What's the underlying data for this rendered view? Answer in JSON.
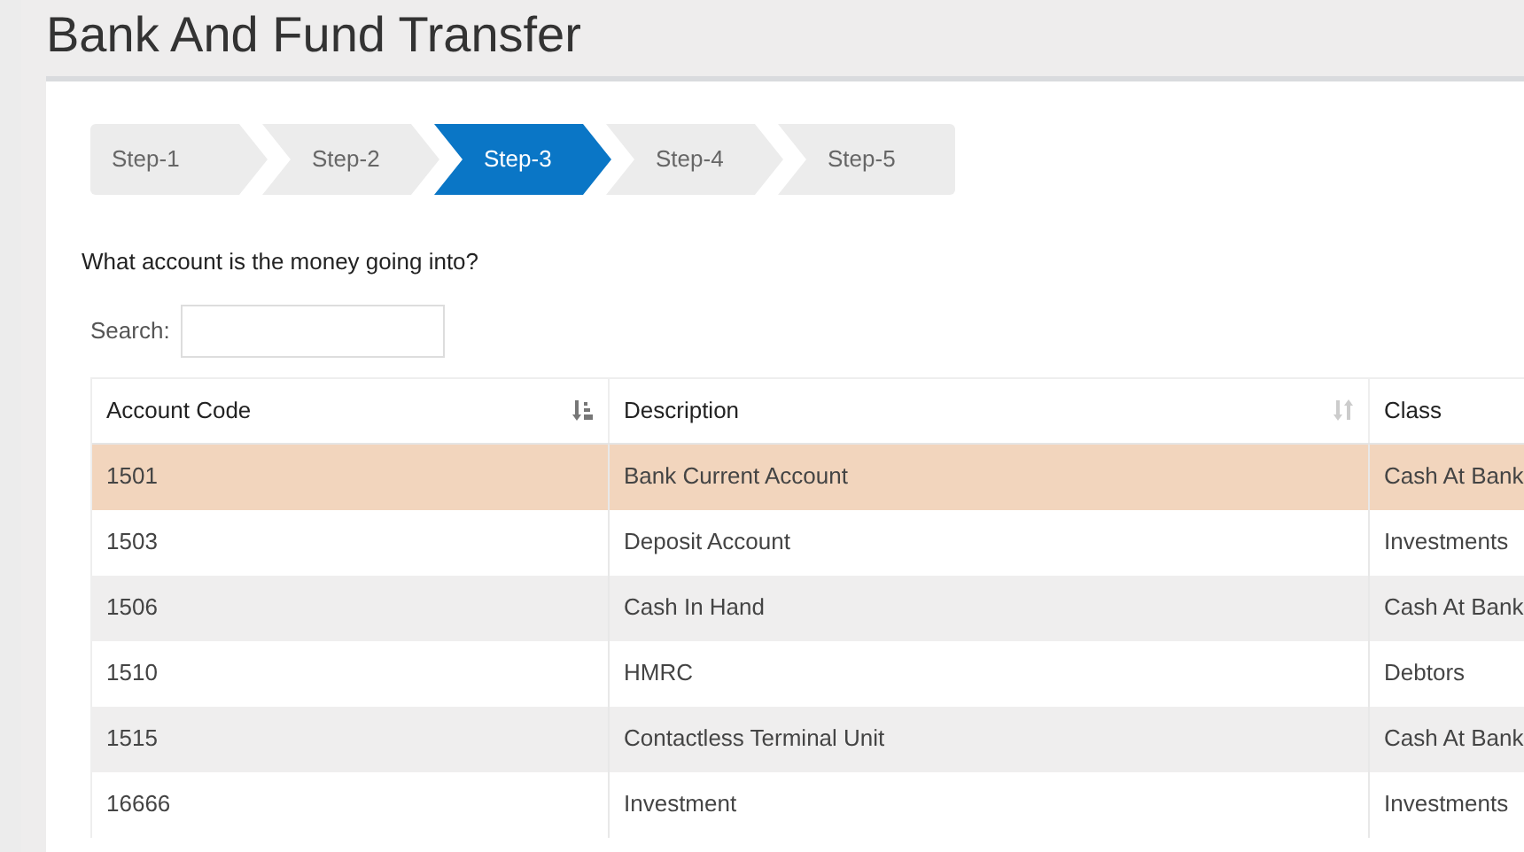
{
  "page_title": "Bank And Fund Transfer",
  "steps": [
    {
      "label": "Step-1",
      "selected": false
    },
    {
      "label": "Step-2",
      "selected": false
    },
    {
      "label": "Step-3",
      "selected": true
    },
    {
      "label": "Step-4",
      "selected": false
    },
    {
      "label": "Step-5",
      "selected": false
    }
  ],
  "question": "What account is the money going into?",
  "search": {
    "label": "Search:"
  },
  "table": {
    "columns": [
      {
        "label": "Account Code",
        "sorted": true
      },
      {
        "label": "Description",
        "sorted": false
      },
      {
        "label": "Class"
      }
    ],
    "rows": [
      {
        "cells": [
          "1501",
          "Bank Current Account",
          "Cash At Bank"
        ],
        "selected": true
      },
      {
        "cells": [
          "1503",
          "Deposit Account",
          "Investments"
        ],
        "selected": false
      },
      {
        "cells": [
          "1506",
          "Cash In Hand",
          "Cash At Bank"
        ],
        "selected": false
      },
      {
        "cells": [
          "1510",
          "HMRC",
          "Debtors"
        ],
        "selected": false
      },
      {
        "cells": [
          "1515",
          "Contactless Terminal Unit",
          "Cash At Bank"
        ],
        "selected": false
      },
      {
        "cells": [
          "16666",
          "Investment",
          "Investments"
        ],
        "selected": false
      }
    ]
  }
}
